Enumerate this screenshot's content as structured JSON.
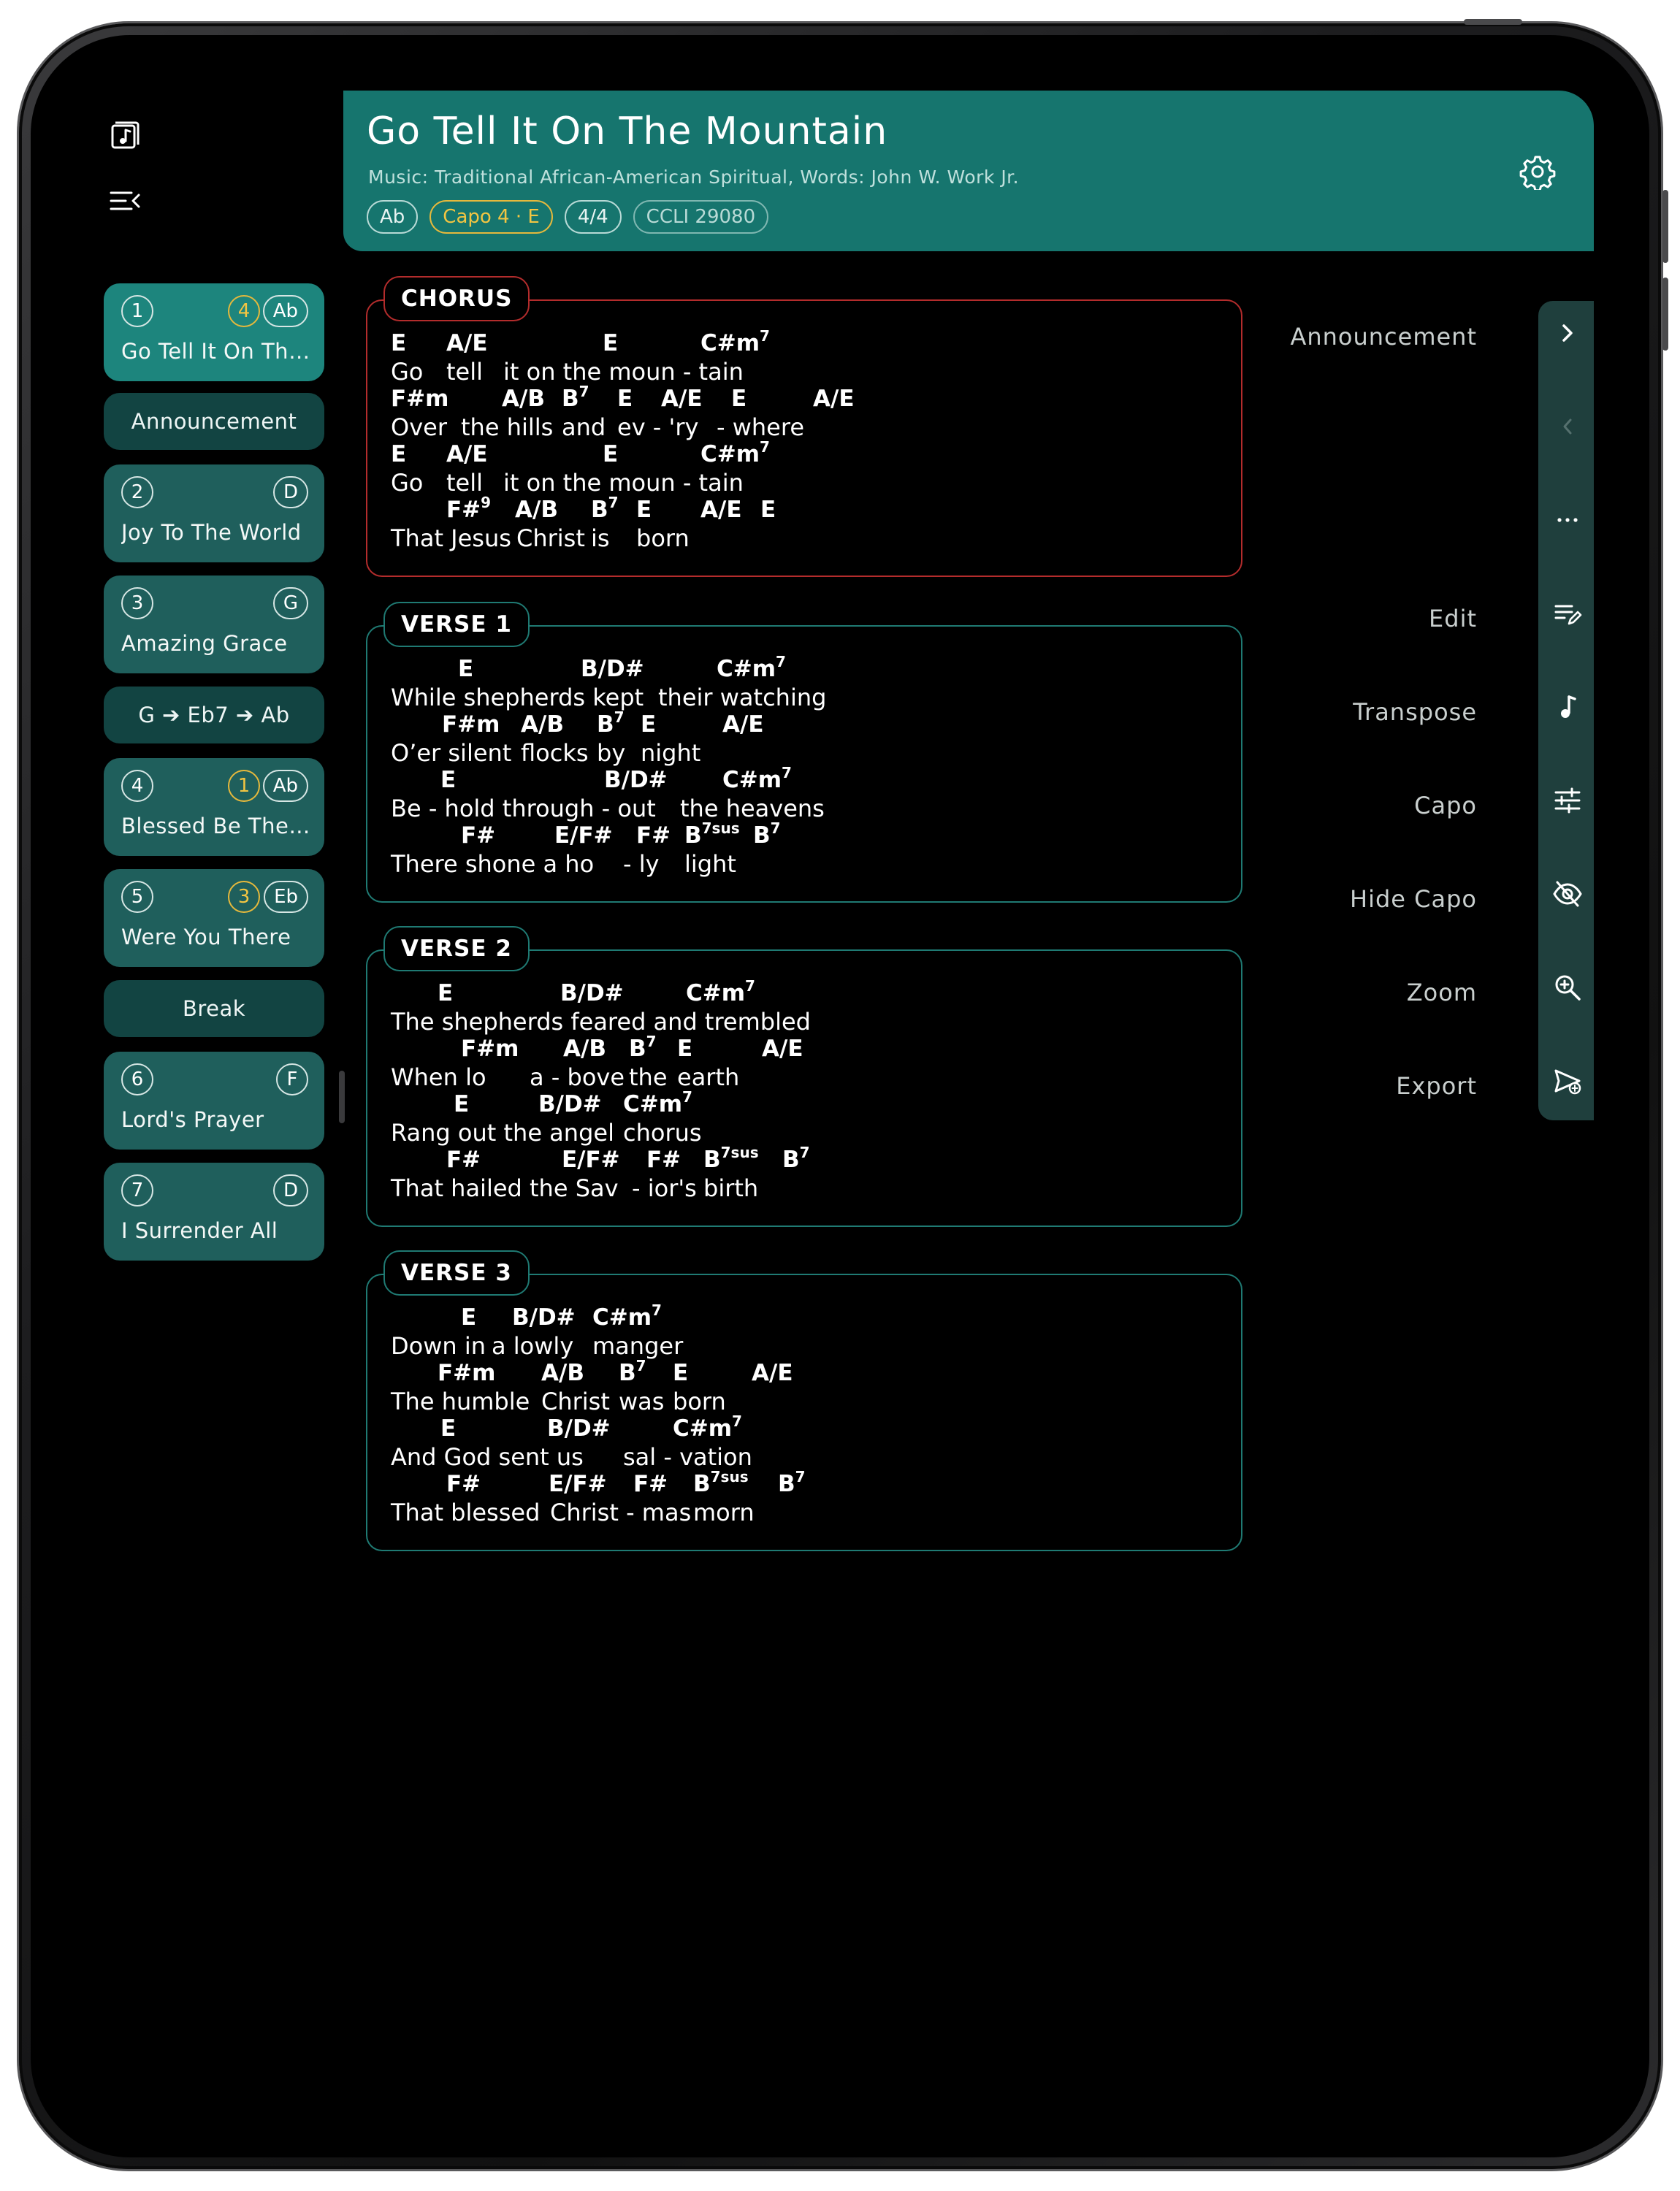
{
  "song": {
    "title": "Go Tell It On The Mountain",
    "subtitle": "Music: Traditional African-American Spiritual, Words: John W. Work Jr.",
    "key": "Ab",
    "capo": "Capo  4  ·  E",
    "time": "4/4",
    "ccli": "CCLI 29080"
  },
  "setlist": [
    {
      "type": "song",
      "num": "1",
      "capo": "4",
      "key": "Ab",
      "title": "Go Tell It On The Mountain",
      "active": true
    },
    {
      "type": "pill",
      "label": "Announcement"
    },
    {
      "type": "song",
      "num": "2",
      "capo": "",
      "key": "D",
      "title": "Joy To The World"
    },
    {
      "type": "song",
      "num": "3",
      "capo": "",
      "key": "G",
      "title": "Amazing Grace"
    },
    {
      "type": "pill",
      "label": "G ➔ Eb7 ➔ Ab"
    },
    {
      "type": "song",
      "num": "4",
      "capo": "1",
      "key": "Ab",
      "title": "Blessed Be The Name"
    },
    {
      "type": "song",
      "num": "5",
      "capo": "3",
      "key": "Eb",
      "title": "Were You There"
    },
    {
      "type": "pill",
      "label": "Break"
    },
    {
      "type": "song",
      "num": "6",
      "capo": "",
      "key": "F",
      "title": "Lord's Prayer"
    },
    {
      "type": "song",
      "num": "7",
      "capo": "",
      "key": "D",
      "title": "I Surrender All"
    }
  ],
  "sections": [
    {
      "label": "CHORUS",
      "kind": "chorus",
      "lines": [
        {
          "chords": [
            [
              "E",
              0
            ],
            [
              "A/E",
              76
            ],
            [
              "E",
              290
            ],
            [
              "C#m",
              424,
              "7"
            ]
          ],
          "lyrics": [
            [
              "Go",
              0
            ],
            [
              "tell",
              76
            ],
            [
              "it on the moun  -  tain",
              154
            ]
          ]
        },
        {
          "chords": [
            [
              "F#m",
              0
            ],
            [
              "A/B",
              152
            ],
            [
              "B",
              234,
              "7"
            ],
            [
              "E",
              310
            ],
            [
              "A/E",
              370
            ],
            [
              "E",
              466
            ],
            [
              "A/E",
              578
            ]
          ],
          "lyrics": [
            [
              "Over",
              0
            ],
            [
              "the hills",
              96
            ],
            [
              "and",
              234
            ],
            [
              "ev - 'ry",
              310
            ],
            [
              "- where",
              446
            ]
          ]
        },
        {
          "chords": [
            [
              "E",
              0
            ],
            [
              "A/E",
              76
            ],
            [
              "E",
              290
            ],
            [
              "C#m",
              424,
              "7"
            ]
          ],
          "lyrics": [
            [
              "Go",
              0
            ],
            [
              "tell",
              76
            ],
            [
              "it on the moun  -  tain",
              154
            ]
          ]
        },
        {
          "chords": [
            [
              "F#",
              76,
              "9"
            ],
            [
              "A/B",
              170
            ],
            [
              "B",
              274,
              "7"
            ],
            [
              "E",
              336
            ],
            [
              "A/E",
              424
            ],
            [
              "E",
              506
            ]
          ],
          "lyrics": [
            [
              "That Jesus",
              0
            ],
            [
              "Christ",
              172
            ],
            [
              "is",
              274
            ],
            [
              "born",
              336
            ]
          ]
        }
      ]
    },
    {
      "label": "VERSE 1",
      "kind": "verse",
      "lines": [
        {
          "chords": [
            [
              "E",
              92
            ],
            [
              "B/D#",
              260
            ],
            [
              "C#m",
              446,
              "7"
            ]
          ],
          "lyrics": [
            [
              "While shepherds kept",
              0
            ],
            [
              "their watching",
              366
            ]
          ]
        },
        {
          "chords": [
            [
              "F#m",
              70
            ],
            [
              "A/B",
              178
            ],
            [
              "B",
              282,
              "7"
            ],
            [
              "E",
              342
            ],
            [
              "A/E",
              454
            ]
          ],
          "lyrics": [
            [
              "O’er silent",
              0
            ],
            [
              "flocks",
              178
            ],
            [
              "by",
              282
            ],
            [
              "night",
              342
            ]
          ]
        },
        {
          "chords": [
            [
              "E",
              68
            ],
            [
              "B/D#",
              292
            ],
            [
              "C#m",
              454,
              "7"
            ]
          ],
          "lyrics": [
            [
              "Be - hold through - out",
              0
            ],
            [
              "the heavens",
              396
            ]
          ]
        },
        {
          "chords": [
            [
              "F#",
              96
            ],
            [
              "E/F#",
              224
            ],
            [
              "F#",
              336
            ],
            [
              "B",
              402,
              "7sus"
            ],
            [
              "B",
              496,
              "7"
            ]
          ],
          "lyrics": [
            [
              "There shone a ho",
              0
            ],
            [
              "- ly",
              318
            ],
            [
              "light",
              402
            ]
          ]
        }
      ]
    },
    {
      "label": "VERSE 2",
      "kind": "verse",
      "lines": [
        {
          "chords": [
            [
              "E",
              64
            ],
            [
              "B/D#",
              232
            ],
            [
              "C#m",
              404,
              "7"
            ]
          ],
          "lyrics": [
            [
              "The shepherds feared and trembled",
              0
            ]
          ]
        },
        {
          "chords": [
            [
              "F#m",
              96
            ],
            [
              "A/B",
              236
            ],
            [
              "B",
              326,
              "7"
            ],
            [
              "E",
              392
            ],
            [
              "A/E",
              508
            ]
          ],
          "lyrics": [
            [
              "When lo",
              0
            ],
            [
              "a - bove",
              190
            ],
            [
              "the",
              326
            ],
            [
              "earth",
              392
            ]
          ]
        },
        {
          "chords": [
            [
              "E",
              86
            ],
            [
              "B/D#",
              202
            ],
            [
              "C#m",
              318,
              "7"
            ]
          ],
          "lyrics": [
            [
              "Rang out the angel",
              0
            ],
            [
              "chorus",
              318
            ]
          ]
        },
        {
          "chords": [
            [
              "F#",
              76
            ],
            [
              "E/F#",
              234
            ],
            [
              "F#",
              350
            ],
            [
              "B",
              428,
              "7sus"
            ],
            [
              "B",
              536,
              "7"
            ]
          ],
          "lyrics": [
            [
              "That hailed the Sav",
              0
            ],
            [
              "- ior's",
              330
            ],
            [
              "birth",
              428
            ]
          ]
        }
      ]
    },
    {
      "label": "VERSE 3",
      "kind": "verse",
      "lines": [
        {
          "chords": [
            [
              "E",
              96
            ],
            [
              "B/D#",
              166
            ],
            [
              "C#m",
              276,
              "7"
            ]
          ],
          "lyrics": [
            [
              "Down in",
              0
            ],
            [
              "a lowly",
              138
            ],
            [
              "manger",
              276
            ]
          ]
        },
        {
          "chords": [
            [
              "F#m",
              64
            ],
            [
              "A/B",
              206
            ],
            [
              "B",
              312,
              "7"
            ],
            [
              "E",
              386
            ],
            [
              "A/E",
              494
            ]
          ],
          "lyrics": [
            [
              "The humble",
              0
            ],
            [
              "Christ",
              206
            ],
            [
              "was",
              312
            ],
            [
              "born",
              386
            ]
          ]
        },
        {
          "chords": [
            [
              "E",
              68
            ],
            [
              "B/D#",
              214
            ],
            [
              "C#m",
              386,
              "7"
            ]
          ],
          "lyrics": [
            [
              "And God sent us",
              0
            ],
            [
              "sal - vation",
              318
            ]
          ]
        },
        {
          "chords": [
            [
              "F#",
              76
            ],
            [
              "E/F#",
              216
            ],
            [
              "F#",
              332
            ],
            [
              "B",
              414,
              "7sus"
            ],
            [
              "B",
              530,
              "7"
            ]
          ],
          "lyrics": [
            [
              "That blessed",
              0
            ],
            [
              "Christ - mas",
              218
            ],
            [
              "morn",
              414
            ]
          ]
        }
      ]
    }
  ],
  "menu": {
    "announcement": "Announcement",
    "edit": "Edit",
    "transpose": "Transpose",
    "capo": "Capo",
    "hide_capo": "Hide Capo",
    "zoom": "Zoom",
    "export": "Export"
  },
  "colors": {
    "accent": "#16756e",
    "active_card": "#1d857d",
    "card": "#1f5f5c",
    "pill": "#124442",
    "chorus_border": "#b32c2c",
    "verse_border": "#1f7a73",
    "capo": "#f2c542"
  },
  "icons": [
    "song-library-icon",
    "collapse-sidebar-icon",
    "settings-icon",
    "chevron-right-icon",
    "chevron-left-icon",
    "more-icon",
    "edit-icon",
    "music-note-icon",
    "sliders-icon",
    "eye-off-icon",
    "zoom-in-icon",
    "export-icon"
  ]
}
